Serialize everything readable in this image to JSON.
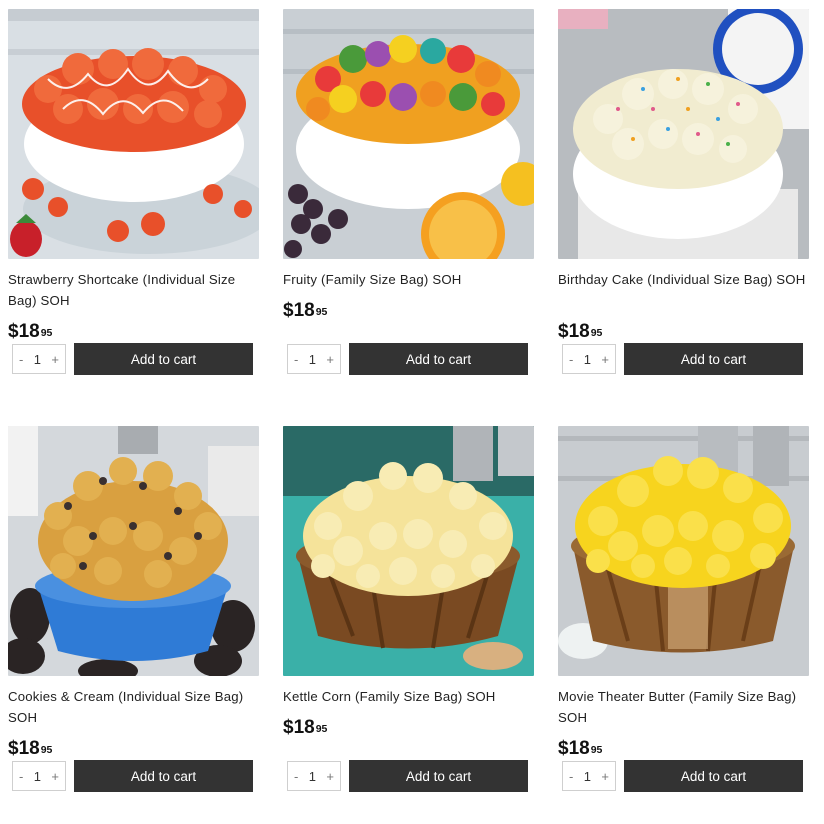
{
  "products": [
    {
      "name": "Strawberry Shortcake (Individual Size Bag) SOH",
      "price_dollars": "$18",
      "price_cents": "95",
      "quantity": "1",
      "add_to_cart": "Add to cart",
      "image_subject": "strawberry-popcorn",
      "colors": {
        "bg": "#d9dfe4",
        "bowl": "#ffffff",
        "kernel": "#e8502a",
        "accent": "#ffffff"
      }
    },
    {
      "name": "Fruity (Family Size Bag) SOH",
      "price_dollars": "$18",
      "price_cents": "95",
      "quantity": "1",
      "add_to_cart": "Add to cart",
      "image_subject": "fruity-popcorn",
      "colors": {
        "bg": "#c9cfd4",
        "bowl": "#ffffff",
        "kernel": "#f0a020",
        "accent": "#9b4fb0"
      }
    },
    {
      "name": "Birthday Cake (Individual Size Bag) SOH",
      "price_dollars": "$18",
      "price_cents": "95",
      "quantity": "1",
      "add_to_cart": "Add to cart",
      "image_subject": "birthday-cake-popcorn",
      "colors": {
        "bg": "#b8bcc0",
        "bowl": "#ffffff",
        "kernel": "#f1ecd0",
        "accent": "#e05a8a"
      }
    },
    {
      "name": "Cookies & Cream (Individual Size Bag) SOH",
      "price_dollars": "$18",
      "price_cents": "95",
      "quantity": "1",
      "add_to_cart": "Add to cart",
      "image_subject": "cookies-cream-popcorn",
      "colors": {
        "bg": "#d4d8dc",
        "bowl": "#2f7bd6",
        "kernel": "#d9a040",
        "accent": "#3a3030"
      }
    },
    {
      "name": "Kettle Corn (Family Size Bag) SOH",
      "price_dollars": "$18",
      "price_cents": "95",
      "quantity": "1",
      "add_to_cart": "Add to cart",
      "image_subject": "kettle-corn-popcorn",
      "colors": {
        "bg": "#3ab0a8",
        "bowl": "#7a4a22",
        "kernel": "#f5e39a",
        "accent": "#ffffff"
      }
    },
    {
      "name": "Movie Theater Butter (Family Size Bag) SOH",
      "price_dollars": "$18",
      "price_cents": "95",
      "quantity": "1",
      "add_to_cart": "Add to cart",
      "image_subject": "butter-popcorn",
      "colors": {
        "bg": "#c8ccd0",
        "bowl": "#8a5a2c",
        "kernel": "#f7d41e",
        "accent": "#ffffff"
      }
    }
  ],
  "controls": {
    "minus": "-",
    "plus": "+"
  }
}
